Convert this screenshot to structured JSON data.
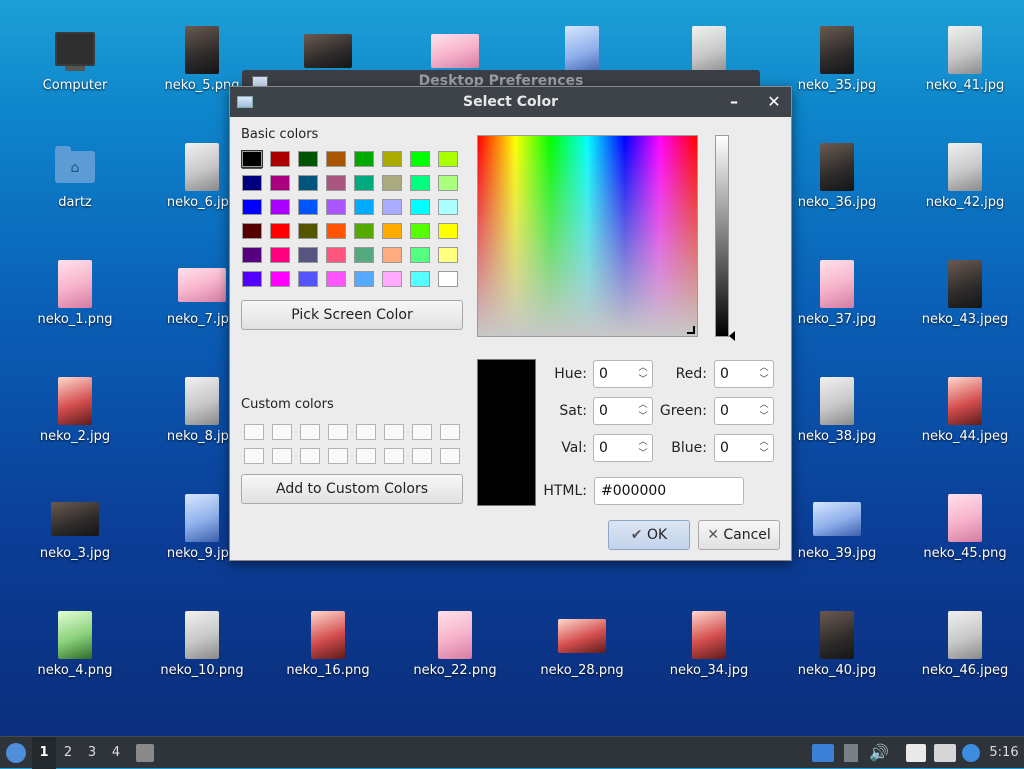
{
  "desktop": {
    "icons": [
      {
        "label": "Computer"
      },
      {
        "label": "neko_5.png"
      },
      {
        "label": ""
      },
      {
        "label": ""
      },
      {
        "label": ""
      },
      {
        "label": ""
      },
      {
        "label": "neko_35.jpg"
      },
      {
        "label": "neko_41.jpg"
      },
      {
        "label": "dartz"
      },
      {
        "label": "neko_6.jpg"
      },
      {
        "label": "neko_36.jpg"
      },
      {
        "label": "neko_42.jpg"
      },
      {
        "label": "neko_1.png"
      },
      {
        "label": "neko_7.jpg"
      },
      {
        "label": "neko_37.jpg"
      },
      {
        "label": "neko_43.jpeg"
      },
      {
        "label": "neko_2.jpg"
      },
      {
        "label": "neko_8.jpg"
      },
      {
        "label": "neko_38.jpg"
      },
      {
        "label": "neko_44.jpeg"
      },
      {
        "label": "neko_3.jpg"
      },
      {
        "label": "neko_9.jpg"
      },
      {
        "label": "neko_39.jpg"
      },
      {
        "label": "neko_45.png"
      },
      {
        "label": "neko_4.png"
      },
      {
        "label": "neko_10.png"
      },
      {
        "label": "neko_16.png"
      },
      {
        "label": "neko_22.png"
      },
      {
        "label": "neko_28.png"
      },
      {
        "label": "neko_34.jpg"
      },
      {
        "label": "neko_40.jpg"
      },
      {
        "label": "neko_46.jpeg"
      }
    ]
  },
  "background_window": {
    "title": "Desktop Preferences"
  },
  "dialog": {
    "title": "Select Color",
    "basic_colors_label": "Basic colors",
    "basic_colors": [
      "#000000",
      "#aa0000",
      "#005500",
      "#aa5500",
      "#00aa00",
      "#aaaa00",
      "#00ff00",
      "#aaff00",
      "#00007f",
      "#aa007f",
      "#00557f",
      "#aa557f",
      "#00aa7f",
      "#aaaa7f",
      "#00ff7f",
      "#aaff7f",
      "#0000ff",
      "#aa00ff",
      "#0055ff",
      "#aa55ff",
      "#00aaff",
      "#aaaaff",
      "#00ffff",
      "#aaffff",
      "#550000",
      "#ff0000",
      "#555500",
      "#ff5500",
      "#55aa00",
      "#ffaa00",
      "#55ff00",
      "#ffff00",
      "#55007f",
      "#ff007f",
      "#55557f",
      "#ff557f",
      "#55aa7f",
      "#ffaa7f",
      "#55ff7f",
      "#ffff7f",
      "#5500ff",
      "#ff00ff",
      "#5555ff",
      "#ff55ff",
      "#55aaff",
      "#ffaaff",
      "#55ffff",
      "#ffffff"
    ],
    "pick_screen_color_label": "Pick Screen Color",
    "custom_colors_label": "Custom colors",
    "add_custom_label": "Add to Custom Colors",
    "fields": {
      "hue_label": "Hue:",
      "hue_value": "0",
      "sat_label": "Sat:",
      "sat_value": "0",
      "val_label": "Val:",
      "val_value": "0",
      "red_label": "Red:",
      "red_value": "0",
      "green_label": "Green:",
      "green_value": "0",
      "blue_label": "Blue:",
      "blue_value": "0",
      "html_label": "HTML:",
      "html_value": "#000000"
    },
    "ok_label": "OK",
    "cancel_label": "Cancel",
    "selected_color": "#000000"
  },
  "taskbar": {
    "workspaces": [
      "1",
      "2",
      "3",
      "4"
    ],
    "clock": "5:16"
  }
}
